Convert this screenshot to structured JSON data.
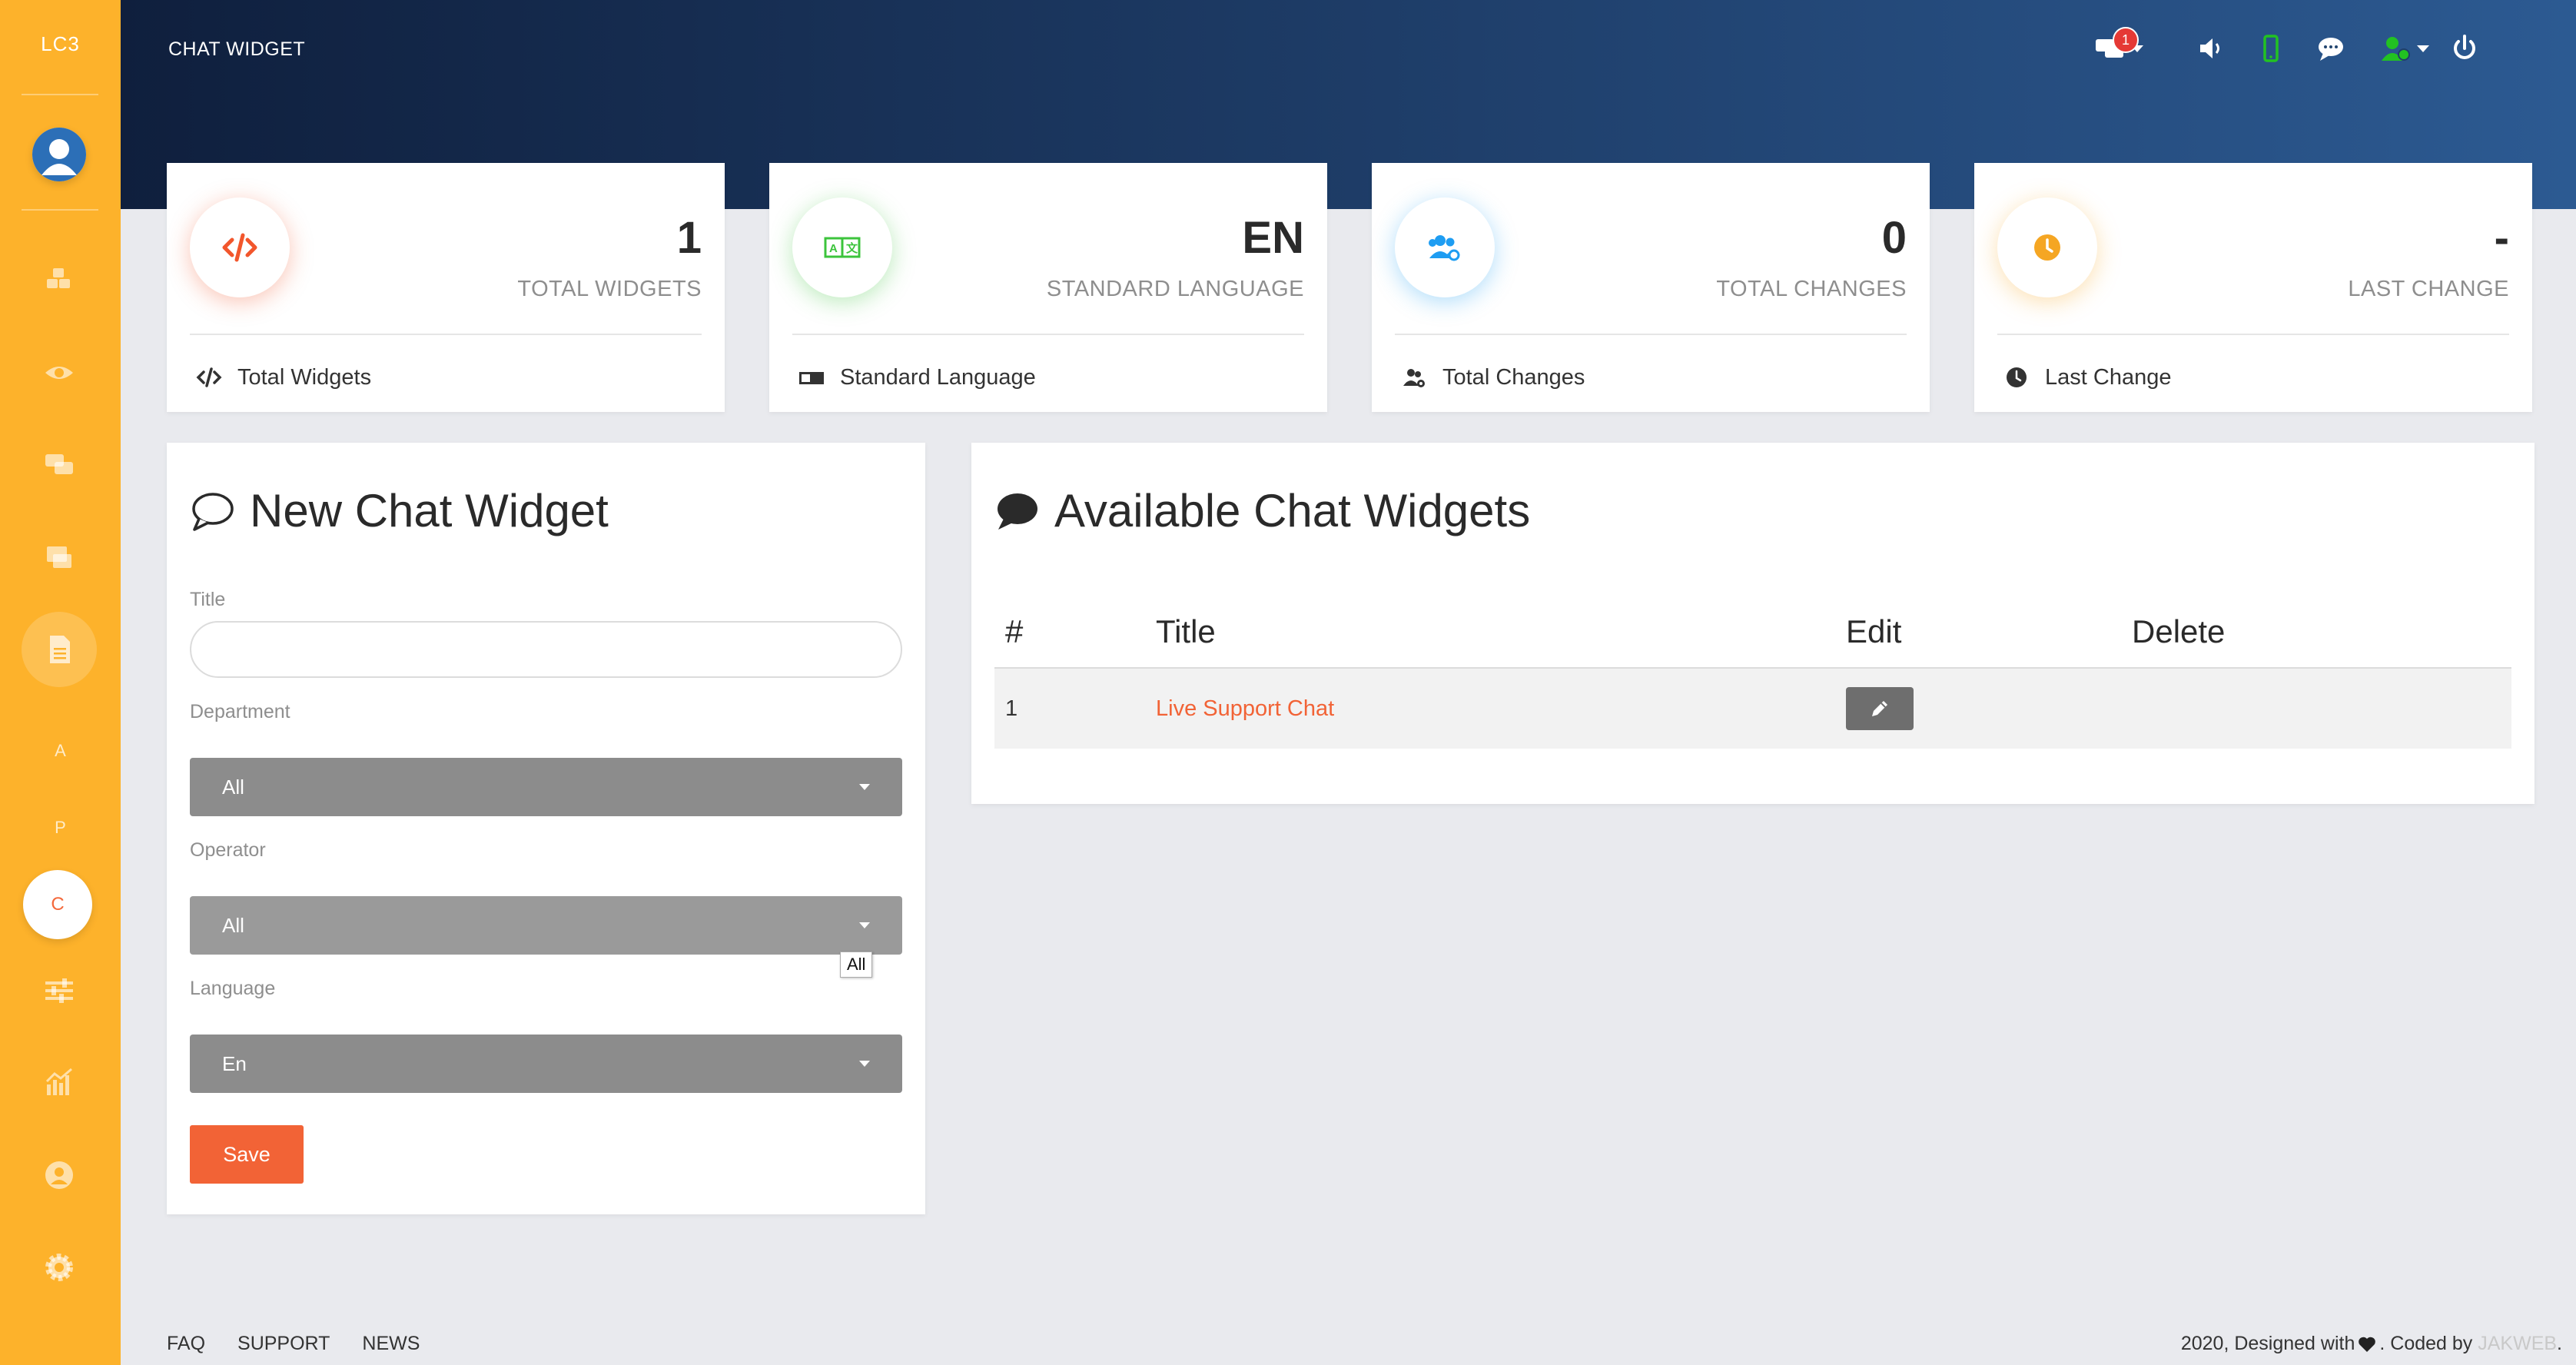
{
  "sidebar": {
    "logo": "LC3",
    "letters": [
      "A",
      "P",
      "C"
    ],
    "icons": [
      "cubes-icon",
      "eye-icon",
      "comments-icon",
      "mailbox-icon",
      "file-icon",
      "sliders-icon",
      "chart-icon",
      "user-circle-icon",
      "gear-icon"
    ],
    "active_icon": "file-icon",
    "active_letter": "C"
  },
  "header": {
    "title": "CHAT WIDGET",
    "notification_count": "1",
    "icons": [
      "chat-notification-icon",
      "volume-icon",
      "mobile-icon",
      "message-icon",
      "user-status-icon",
      "power-icon"
    ]
  },
  "stats": [
    {
      "value": "1",
      "label": "TOTAL WIDGETS",
      "footer": "Total Widgets",
      "icon": "code-icon",
      "color": "#f2562c"
    },
    {
      "value": "EN",
      "label": "STANDARD LANGUAGE",
      "footer": "Standard Language",
      "icon": "language-icon",
      "color": "#3cc43c"
    },
    {
      "value": "0",
      "label": "TOTAL CHANGES",
      "footer": "Total Changes",
      "icon": "users-gear-icon",
      "color": "#1e9df2"
    },
    {
      "value": "-",
      "label": "LAST CHANGE",
      "footer": "Last Change",
      "icon": "clock-icon",
      "color": "#f5a623"
    }
  ],
  "form": {
    "title": "New Chat Widget",
    "title_label": "Title",
    "title_value": "",
    "department_label": "Department",
    "department_value": "All",
    "operator_label": "Operator",
    "operator_value": "All",
    "operator_tooltip": "All",
    "language_label": "Language",
    "language_value": "En",
    "save_label": "Save"
  },
  "widgets": {
    "title": "Available Chat Widgets",
    "columns": [
      "#",
      "Title",
      "Edit",
      "Delete"
    ],
    "rows": [
      {
        "num": "1",
        "title": "Live Support Chat"
      }
    ]
  },
  "footer": {
    "links": [
      "FAQ",
      "SUPPORT",
      "NEWS"
    ],
    "credit_prefix": "2020, Designed with",
    "credit_middle": ". Coded by",
    "brand": "JAKWEB",
    "credit_suffix": "."
  },
  "colors": {
    "sidebar": "#fdb22b",
    "accent": "#f26336",
    "header_start": "#0f1f3d",
    "header_end": "#2c5a92"
  }
}
